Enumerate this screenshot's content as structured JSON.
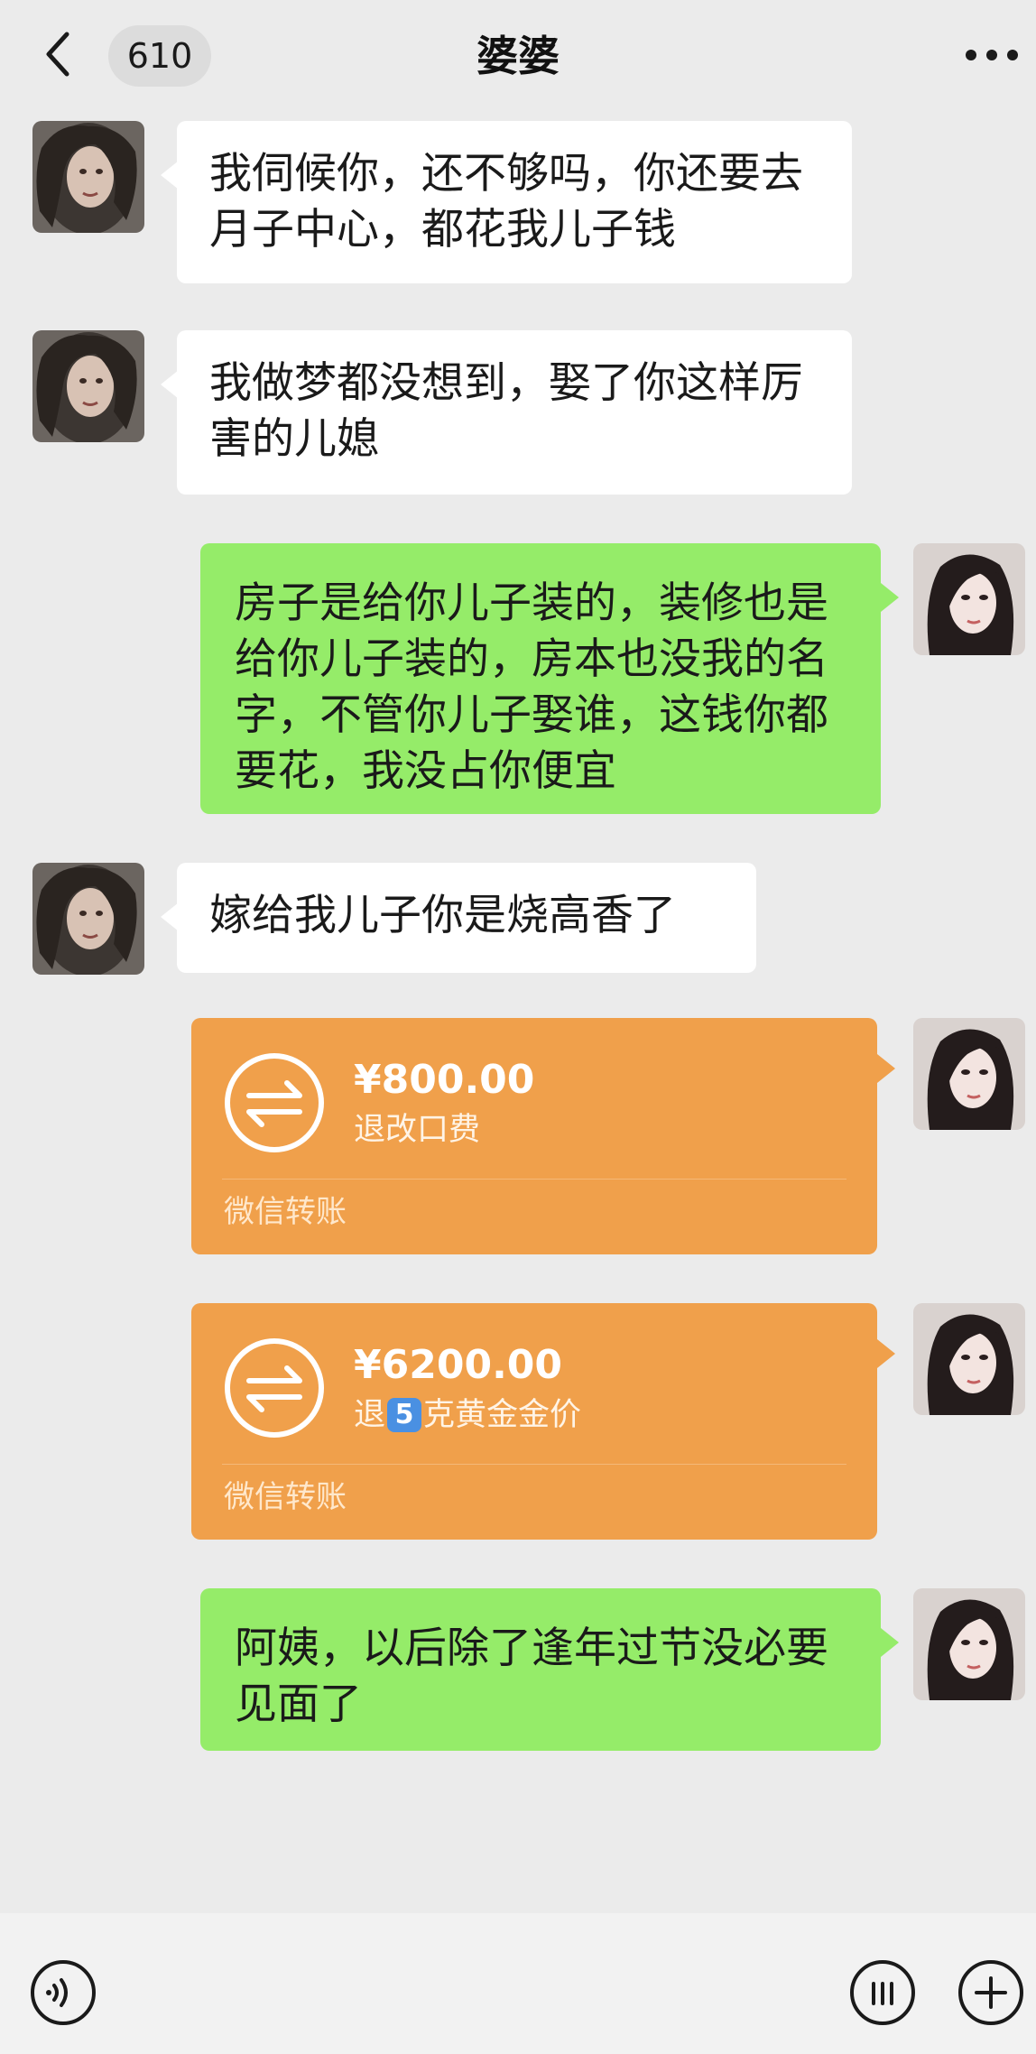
{
  "header": {
    "back_icon": "chevron-left-icon",
    "unread_count": "610",
    "title": "婆婆",
    "more_icon": "ellipsis-icon"
  },
  "messages": [
    {
      "side": "in",
      "text": "我伺候你，还不够吗，你还要去月子中心，都花我儿子钱"
    },
    {
      "side": "in",
      "text": "我做梦都没想到，娶了你这样厉害的儿媳"
    },
    {
      "side": "out",
      "text": "房子是给你儿子装的，装修也是给你儿子装的，房本也没我的名字，不管你儿子娶谁，这钱你都要花，我没占你便宜"
    },
    {
      "side": "in",
      "text": "嫁给我儿子你是烧高香了"
    },
    {
      "side": "out",
      "type": "transfer",
      "amount": "¥800.00",
      "note": "退改口费",
      "label": "微信转账"
    },
    {
      "side": "out",
      "type": "transfer",
      "amount": "¥6200.00",
      "note_prefix": "退",
      "note_badge": "5",
      "note_suffix": "克黄金金价",
      "label": "微信转账"
    },
    {
      "side": "out",
      "text": "阿姨，以后除了逢年过节没必要见面了"
    }
  ],
  "footer": {
    "voice_icon": "voice-input-icon",
    "emoji_icon": "emoji-icon",
    "plus_icon": "plus-icon"
  },
  "colors": {
    "background": "#ebebeb",
    "outgoing_bubble": "#95ec69",
    "incoming_bubble": "#ffffff",
    "transfer_card": "#f0a04b"
  }
}
